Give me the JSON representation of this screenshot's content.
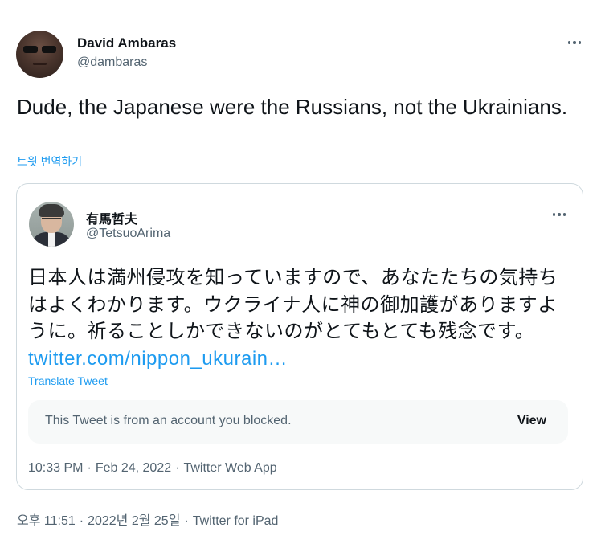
{
  "tweet": {
    "author": {
      "name": "David Ambaras",
      "handle": "@dambaras",
      "avatar_icon": "user-avatar"
    },
    "text": "Dude, the Japanese were the Russians, not the Ukrainians.",
    "translate_label": "트윗 번역하기",
    "meta": {
      "time": "오후 11:51",
      "date": "2022년 2월 25일",
      "source": "Twitter for iPad",
      "separator": "·"
    },
    "more_icon": "more-horizontal-icon"
  },
  "quoted": {
    "author": {
      "name": "有馬哲夫",
      "handle": "@TetsuoArima",
      "avatar_icon": "user-avatar"
    },
    "text": "日本人は満州侵攻を知っていますので、あなたたちの気持ちはよくわかります。ウクライナ人に神の御加護がありますように。祈ることしかできないのがとてもとても残念です。",
    "link": "twitter.com/nippon_ukurain…",
    "translate_label": "Translate Tweet",
    "blocked_notice": "This Tweet is from an account you blocked.",
    "view_label": "View",
    "meta": {
      "time": "10:33 PM",
      "date": "Feb 24, 2022",
      "source": "Twitter Web App",
      "separator": "·"
    },
    "more_icon": "more-horizontal-icon"
  },
  "colors": {
    "link": "#1d9bf0",
    "secondary_text": "#536471",
    "primary_text": "#0f1419",
    "border": "#cfd9de",
    "notice_bg": "#f7f9f9"
  }
}
